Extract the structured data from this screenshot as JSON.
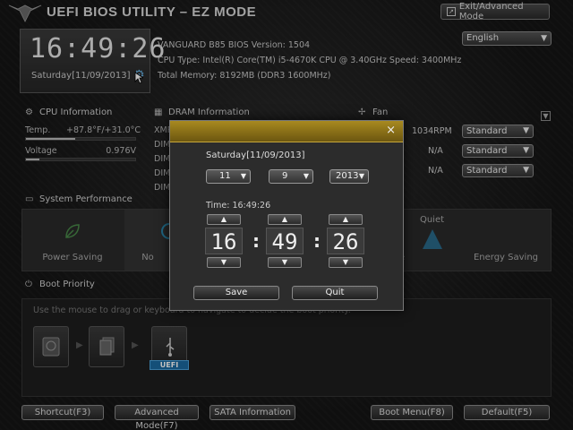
{
  "header": {
    "title": "UEFI BIOS UTILITY – EZ MODE",
    "exit_label": "Exit/Advanced Mode",
    "language": "English"
  },
  "clock": {
    "time": "16:49:26",
    "date": "Saturday[11/09/2013]"
  },
  "sysinfo": {
    "line1": "VANGUARD B85    BIOS Version: 1504",
    "line2": "CPU Type: Intel(R) Core(TM) i5-4670K CPU @ 3.40GHz   Speed: 3400MHz",
    "line3": "Total Memory: 8192MB (DDR3 1600MHz)"
  },
  "cpu": {
    "title": "CPU Information",
    "temp_label": "Temp.",
    "temp_value": "+87.8°F/+31.0°C",
    "temp_level": 0.45,
    "voltage_label": "Voltage",
    "voltage_value": "0.976V",
    "voltage_level": 0.12
  },
  "dram": {
    "title": "DRAM Information",
    "rows": [
      "XMP",
      "DIMM",
      "DIMM",
      "DIMM",
      "DIMM"
    ]
  },
  "fan": {
    "title": "Fan",
    "rows": [
      {
        "rpm": "1034RPM",
        "mode": "Standard"
      },
      {
        "rpm": "N/A",
        "mode": "Standard"
      },
      {
        "rpm": "N/A",
        "mode": "Standard"
      }
    ]
  },
  "performance": {
    "title": "System Performance",
    "items": [
      "Power Saving",
      "No",
      "Quiet",
      "Energy Saving"
    ],
    "partial": "e"
  },
  "boot": {
    "title": "Boot Priority",
    "hint": "Use the mouse to drag or keyboard to navigate to decide the boot priority.",
    "uefi_tag": "UEFI"
  },
  "footer": {
    "shortcut": "Shortcut(F3)",
    "advanced": "Advanced Mode(F7)",
    "sata": "SATA Information",
    "boot_menu": "Boot Menu(F8)",
    "default": "Default(F5)"
  },
  "dialog": {
    "date_label": "Saturday[11/09/2013]",
    "month": "11",
    "day": "9",
    "year": "2013",
    "time_label": "Time: 16:49:26",
    "hour": "16",
    "minute": "49",
    "second": "26",
    "save": "Save",
    "quit": "Quit",
    "close_icon": "×",
    "up_icon": "▲",
    "down_icon": "▼"
  },
  "colors": {
    "dialog_title": "#a88a20",
    "uefi_tag": "#1b6aa0",
    "gear": "#66b0e0"
  }
}
